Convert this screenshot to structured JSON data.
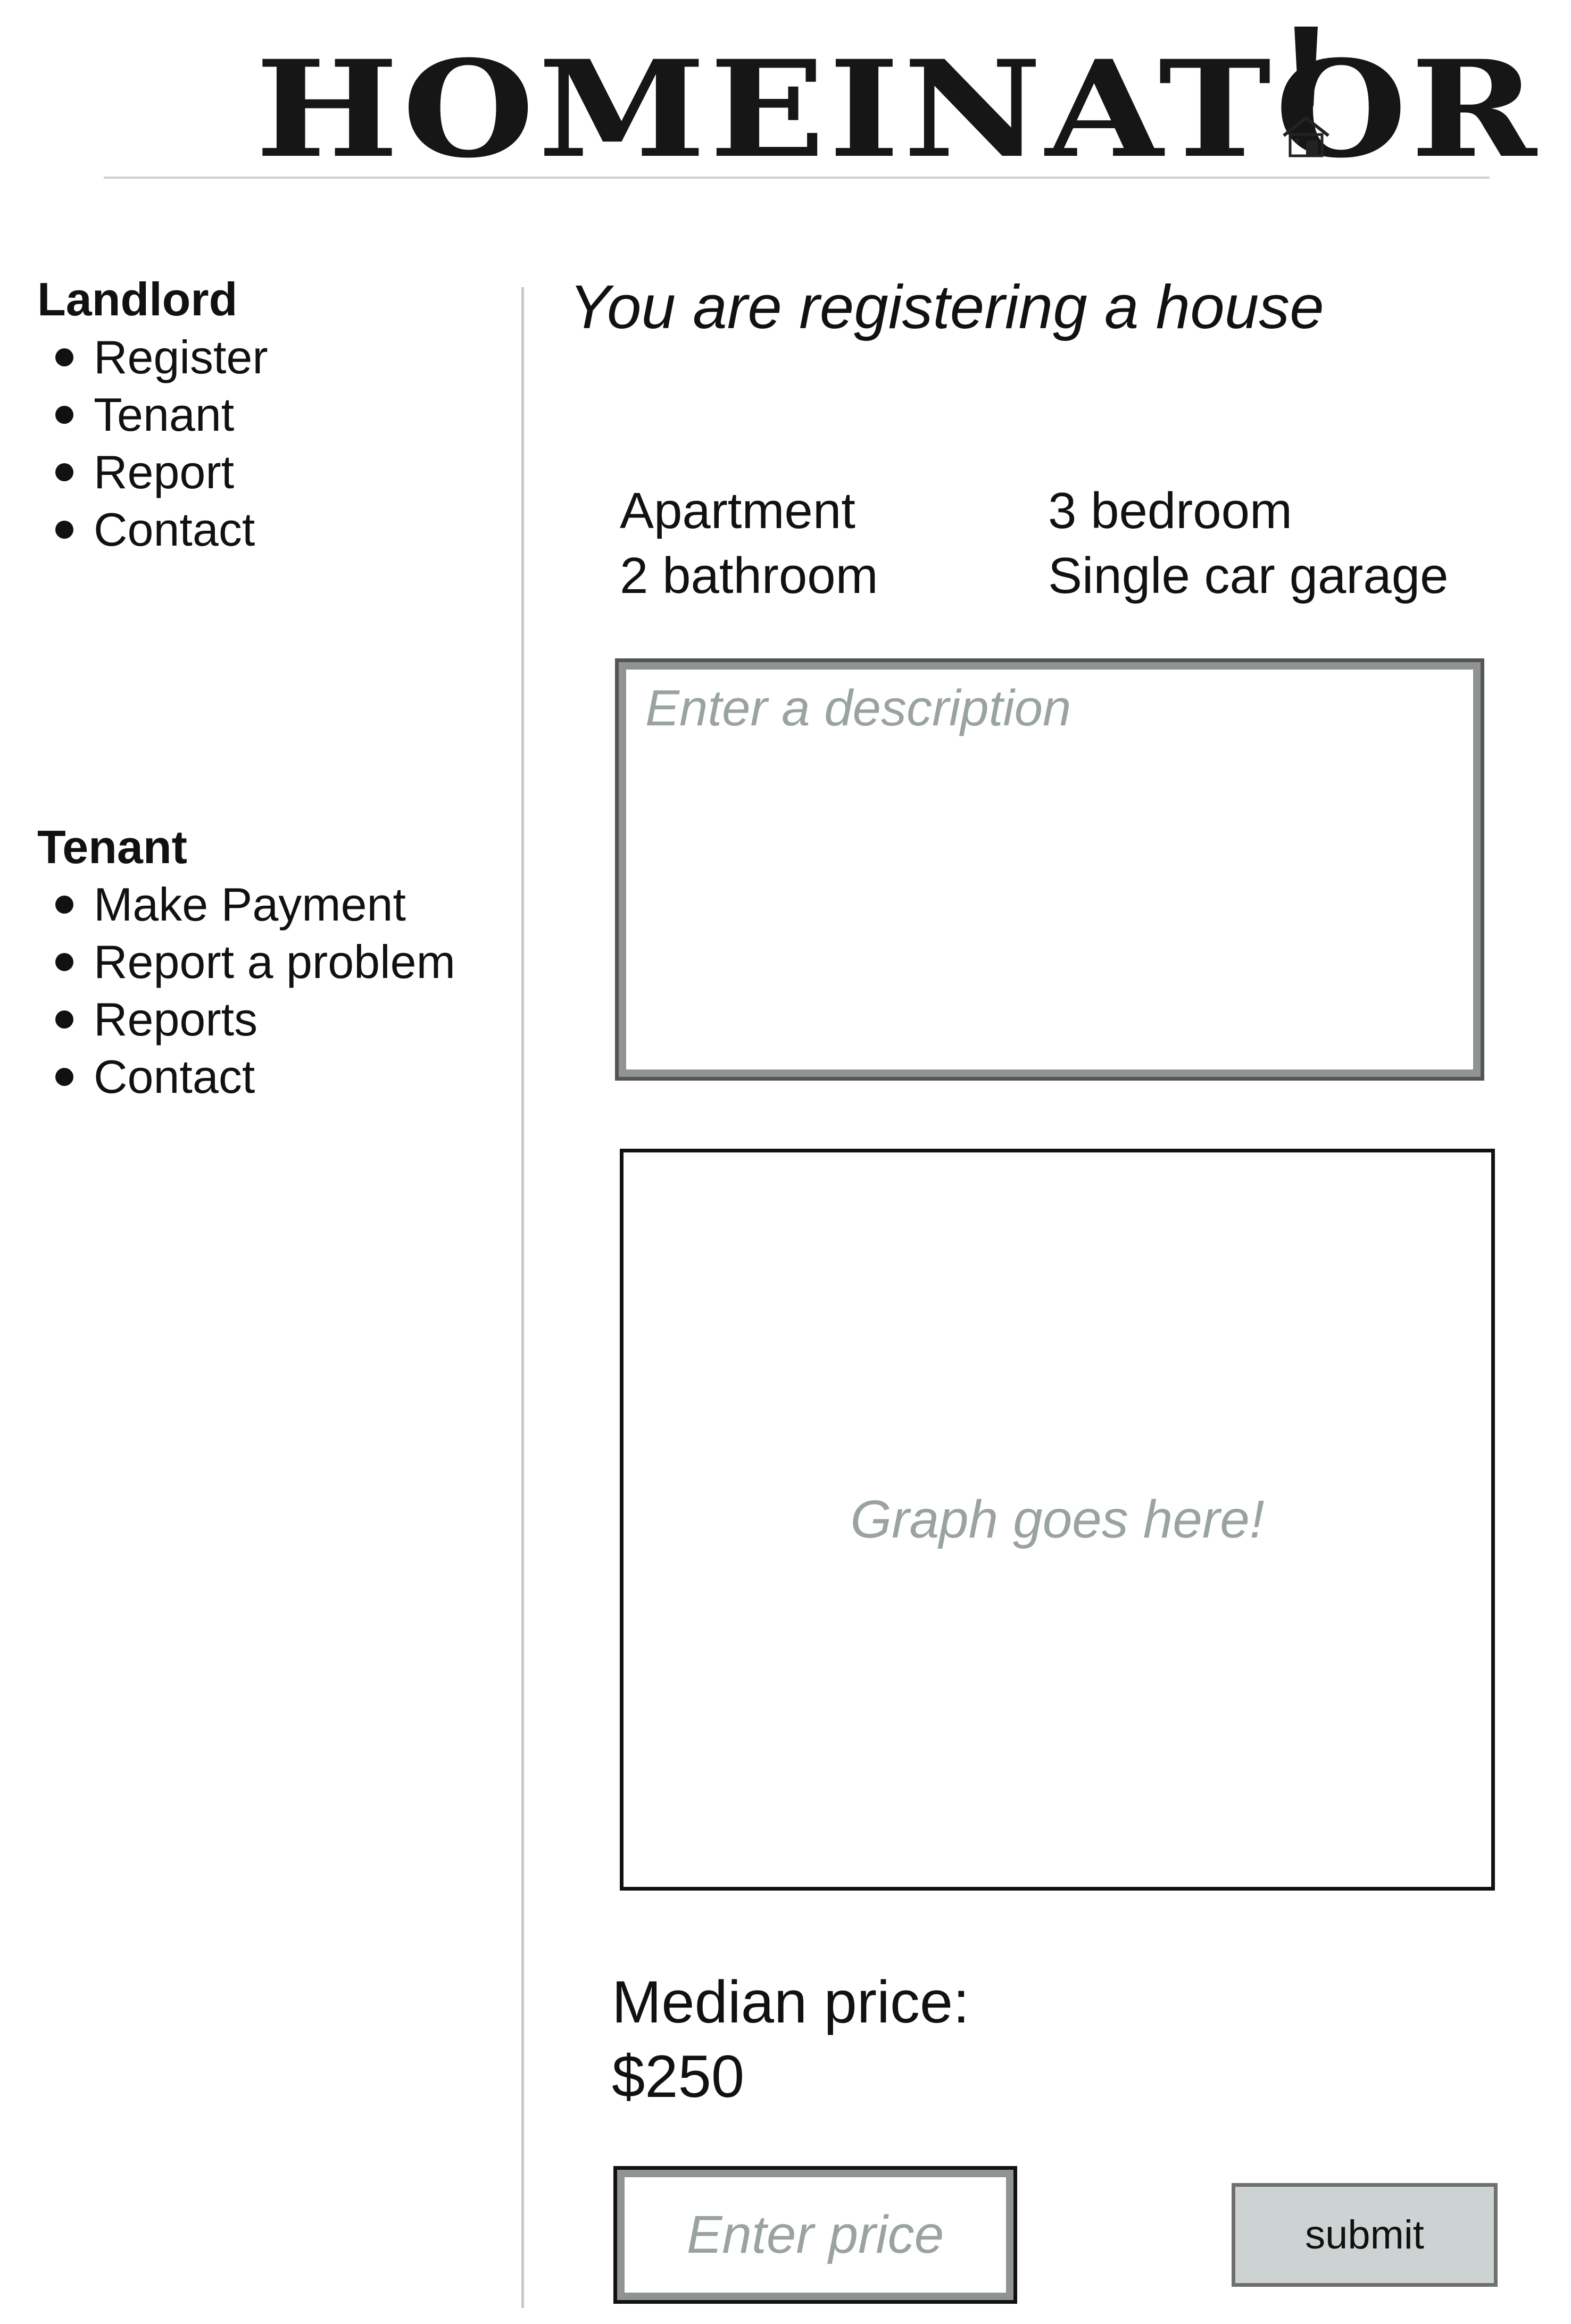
{
  "header": {
    "logo_text": "HOMEINATOR",
    "logo_mark": "exclamation-house"
  },
  "sidebar": {
    "groups": [
      {
        "heading": "Landlord",
        "items": [
          "Register",
          "Tenant",
          "Report",
          "Contact"
        ]
      },
      {
        "heading": "Tenant",
        "items": [
          "Make Payment",
          "Report a problem",
          "Reports",
          "Contact"
        ]
      }
    ]
  },
  "main": {
    "title": "You are registering a house",
    "specs": [
      "Apartment",
      "3 bedroom",
      "2 bathroom",
      "Single car garage"
    ],
    "description_placeholder": "Enter a description",
    "graph_placeholder": "Graph goes here!",
    "median_label": "Median price:",
    "median_value": "$250",
    "price_placeholder": "Enter price",
    "submit_label": "submit"
  },
  "colors": {
    "text": "#111111",
    "placeholder": "#9aa3a0",
    "input_border_inner": "#8f9490",
    "button_fill": "#cdd3d3",
    "divider": "#c8c8c8"
  }
}
